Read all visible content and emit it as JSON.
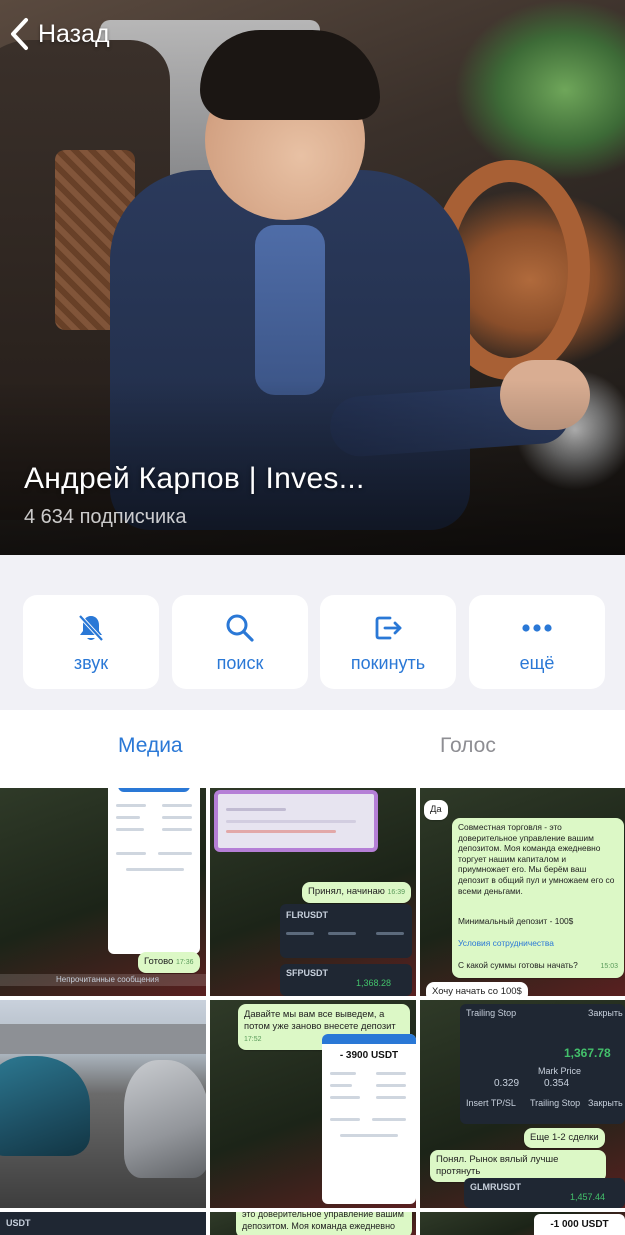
{
  "header": {
    "back_label": "Назад"
  },
  "channel": {
    "name": "Андрей Карпов | Inves...",
    "subscribers": "4 634 подписчика"
  },
  "actions": [
    {
      "label": "звук",
      "icon": "bell-muted-icon"
    },
    {
      "label": "поиск",
      "icon": "search-icon"
    },
    {
      "label": "покинуть",
      "icon": "leave-icon"
    },
    {
      "label": "ещё",
      "icon": "more-dots-icon"
    }
  ],
  "tabs": [
    {
      "label": "Медиа",
      "active": true
    },
    {
      "label": "Голос",
      "active": false
    }
  ],
  "media": {
    "t1": {
      "done": "Готово",
      "done_time": "17:36",
      "footer": "Непрочитанные сообщения"
    },
    "t2": {
      "reply": "Принял, начинаю",
      "reply_time": "16:39",
      "pair1": "FLRUSDT",
      "pair2": "SFPUSDT",
      "pnl2": "1,368.28"
    },
    "t3": {
      "yes": "Да",
      "offer": "Совместная торговля - это доверительное управление вашим депозитом. Моя команда ежедневно торгует нашим капиталом и приумножает его. Мы берём ваш депозит в общий пул и умножаем его со всеми деньгами.",
      "min_deposit": "Минимальный депозит - 100$",
      "terms_link": "Условия сотрудничества",
      "question": "С какой суммы готовы начать?",
      "question_time": "15:03",
      "answer": "Хочу начать со 100$"
    },
    "t5": {
      "msg": "Давайте мы вам все выведем, а потом уже заново внесете депозит",
      "msg_time": "17:52",
      "amount": "- 3900 USDT",
      "footer": "это доверительное управление вашим депозитом. Моя команда ежедневно"
    },
    "t6": {
      "btn1": "Trailing Stop",
      "btn2": "Закрыть с",
      "price": "1,367.78",
      "lbl1": "Mark Price",
      "val1": "0.329",
      "val2": "0.354",
      "btn3": "Insert TP/SL",
      "btn4": "Trailing Stop",
      "btn5": "Закрыть с",
      "reply1": "Еще 1-2 сделки",
      "reply2": "Понял. Рынок вялый лучше протянуть",
      "pair": "GLMRUSDT",
      "pnl": "1,457.44"
    },
    "t7": {
      "label": "USDT"
    },
    "t9": {
      "amount": "-1 000 USDT"
    }
  }
}
